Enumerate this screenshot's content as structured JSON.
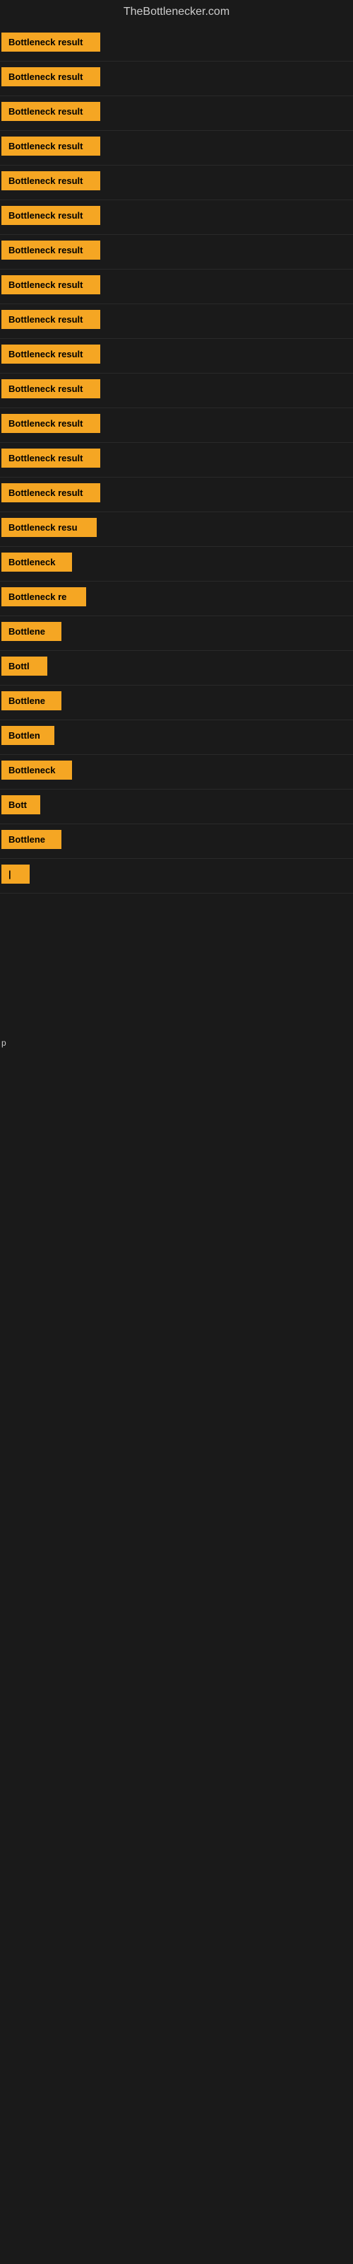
{
  "site": {
    "title": "TheBottlenecker.com"
  },
  "rows": [
    {
      "id": 1,
      "label": "Bottleneck result",
      "badgeClass": "badge-full",
      "yOffset": 57
    },
    {
      "id": 2,
      "label": "Bottleneck result",
      "badgeClass": "badge-full",
      "yOffset": 143
    },
    {
      "id": 3,
      "label": "Bottleneck result",
      "badgeClass": "badge-full",
      "yOffset": 234
    },
    {
      "id": 4,
      "label": "Bottleneck result",
      "badgeClass": "badge-full",
      "yOffset": 321
    },
    {
      "id": 5,
      "label": "Bottleneck result",
      "badgeClass": "badge-full",
      "yOffset": 411
    },
    {
      "id": 6,
      "label": "Bottleneck result",
      "badgeClass": "badge-full",
      "yOffset": 500
    },
    {
      "id": 7,
      "label": "Bottleneck result",
      "badgeClass": "badge-full",
      "yOffset": 590
    },
    {
      "id": 8,
      "label": "Bottleneck result",
      "badgeClass": "badge-full",
      "yOffset": 675
    },
    {
      "id": 9,
      "label": "Bottleneck result",
      "badgeClass": "badge-full",
      "yOffset": 762
    },
    {
      "id": 10,
      "label": "Bottleneck result",
      "badgeClass": "badge-full",
      "yOffset": 852
    },
    {
      "id": 11,
      "label": "Bottleneck result",
      "badgeClass": "badge-full",
      "yOffset": 942
    },
    {
      "id": 12,
      "label": "Bottleneck result",
      "badgeClass": "badge-full",
      "yOffset": 1030
    },
    {
      "id": 13,
      "label": "Bottleneck result",
      "badgeClass": "badge-full",
      "yOffset": 1120
    },
    {
      "id": 14,
      "label": "Bottleneck result",
      "badgeClass": "badge-full",
      "yOffset": 1210
    },
    {
      "id": 15,
      "label": "Bottleneck resu",
      "badgeClass": "badge-w3",
      "yOffset": 1295
    },
    {
      "id": 16,
      "label": "Bottleneck",
      "badgeClass": "badge-w5",
      "yOffset": 1380
    },
    {
      "id": 17,
      "label": "Bottleneck re",
      "badgeClass": "badge-w4",
      "yOffset": 1465
    },
    {
      "id": 18,
      "label": "Bottlene",
      "badgeClass": "badge-w6",
      "yOffset": 1550
    },
    {
      "id": 19,
      "label": "Bottl",
      "badgeClass": "badge-w8",
      "yOffset": 1635
    },
    {
      "id": 20,
      "label": "Bottlene",
      "badgeClass": "badge-w6",
      "yOffset": 1720
    },
    {
      "id": 21,
      "label": "Bottlen",
      "badgeClass": "badge-w7",
      "yOffset": 1805
    },
    {
      "id": 22,
      "label": "Bottleneck",
      "badgeClass": "badge-w5",
      "yOffset": 1895
    },
    {
      "id": 23,
      "label": "Bott",
      "badgeClass": "badge-w9",
      "yOffset": 1980
    },
    {
      "id": 24,
      "label": "Bottlene",
      "badgeClass": "badge-w6",
      "yOffset": 2065
    },
    {
      "id": 25,
      "label": "|",
      "badgeClass": "badge-w11",
      "yOffset": 2150
    }
  ],
  "bottom_section": {
    "label": "p",
    "yOffset": 2650
  }
}
